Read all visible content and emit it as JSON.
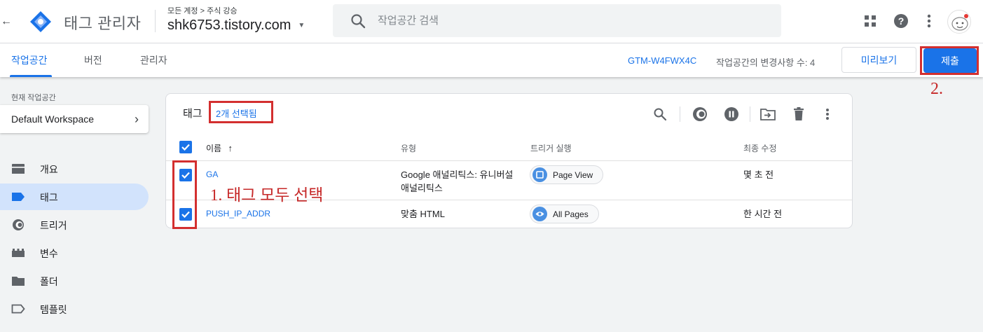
{
  "header": {
    "app_title": "태그 관리자",
    "breadcrumb": "모든 계정 > 주식 강승",
    "account": "shk6753.tistory.com",
    "search_placeholder": "작업공간 검색"
  },
  "nav": {
    "tabs": [
      {
        "label": "작업공간",
        "active": true
      },
      {
        "label": "버전",
        "active": false
      },
      {
        "label": "관리자",
        "active": false
      }
    ],
    "container_id": "GTM-W4FWX4C",
    "changes": "작업공간의 변경사항 수: 4",
    "preview_label": "미리보기",
    "submit_label": "제출"
  },
  "sidebar": {
    "workspace_label": "현재 작업공간",
    "workspace_name": "Default Workspace",
    "items": [
      {
        "label": "개요",
        "icon": "overview-icon",
        "active": false
      },
      {
        "label": "태그",
        "icon": "tag-icon",
        "active": true
      },
      {
        "label": "트리거",
        "icon": "trigger-icon",
        "active": false
      },
      {
        "label": "변수",
        "icon": "variables-icon",
        "active": false
      },
      {
        "label": "폴더",
        "icon": "folder-icon",
        "active": false
      },
      {
        "label": "템플릿",
        "icon": "template-icon",
        "active": false
      }
    ]
  },
  "tags_card": {
    "title": "태그",
    "selected_text": "2개 선택됨",
    "columns": {
      "name": "이름",
      "type": "유형",
      "trigger": "트리거 실행",
      "modified": "최종 수정"
    },
    "rows": [
      {
        "name": "GA",
        "type_line1": "Google 애널리틱스: 유니버설",
        "type_line2": "애널리틱스",
        "trigger": "Page View",
        "modified": "몇 초 전",
        "checked": true
      },
      {
        "name": "PUSH_IP_ADDR",
        "type_line1": "맞춤 HTML",
        "type_line2": "",
        "trigger": "All Pages",
        "modified": "한 시간 전",
        "checked": true
      }
    ]
  },
  "annotations": {
    "step1": "1. 태그 모두 선택",
    "step2": "2.",
    "color": "#d32f2f"
  },
  "colors": {
    "accent": "#1a73e8",
    "active_nav_bg": "#d2e3fc",
    "page_bg": "#f1f3f4"
  }
}
